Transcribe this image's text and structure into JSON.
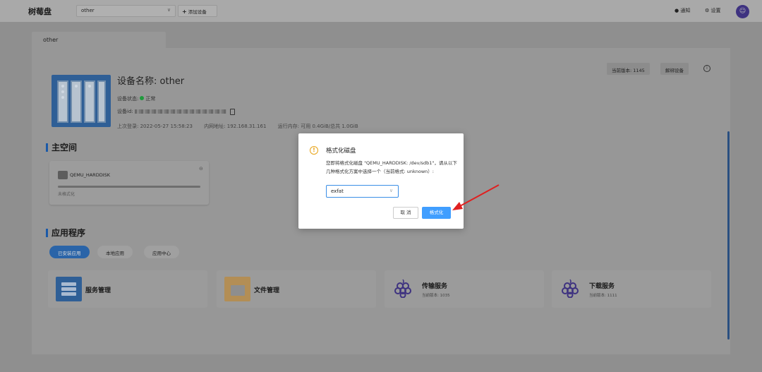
{
  "topbar": {
    "brand": "树莓盘",
    "device_select_value": "other",
    "add_device_label": "添加设备",
    "notify_label": "通知",
    "settings_label": "设置",
    "avatar_icon": "avatar-icon"
  },
  "tabs": [
    {
      "label": "other"
    }
  ],
  "device": {
    "title": "设备名称: other",
    "status_label": "设备状态:",
    "status_value": "正常",
    "status_color": "#1f9a3c",
    "id_label": "设备id:",
    "last_login": "上次登录: 2022-05-27 15:58:23",
    "lan_ip": "内网地址: 192.168.31.161",
    "memory": "运行内存: 可用 0.4GiB/总共 1.0GiB",
    "version_badge": "当前版本: 1145",
    "unbind_label": "解绑设备"
  },
  "main_space": {
    "title": "主空间",
    "disk": {
      "name": "QEMU_HARDDISK",
      "state": "未格式化"
    }
  },
  "apps": {
    "title": "应用程序",
    "tabs": [
      {
        "label": "已安装应用",
        "active": true
      },
      {
        "label": "本地应用",
        "active": false
      },
      {
        "label": "应用中心",
        "active": false
      }
    ],
    "cards": [
      {
        "name": "服务管理",
        "version": "",
        "icon": "server-icon",
        "color": "#2f5f96"
      },
      {
        "name": "文件管理",
        "version": "",
        "icon": "folder-icon",
        "color": "#c69d5c"
      },
      {
        "name": "传输服务",
        "version": "当前版本: 1035",
        "icon": "grape-icon",
        "color": "#3e3280"
      },
      {
        "name": "下载服务",
        "version": "当前版本: 1111",
        "icon": "grape-icon",
        "color": "#3e3280"
      }
    ]
  },
  "modal": {
    "title": "格式化磁盘",
    "message": "您即将格式化磁盘 \"QEMU_HARDDISK: /dev/sdb1\"，请从以下几种格式化方案中选择一个（当前格式: unknown）:",
    "format_value": "exfat",
    "cancel_label": "取 消",
    "confirm_label": "格式化",
    "accent_color": "#409eff",
    "warn_color": "#e8a317"
  },
  "annotation_color": "#e02020"
}
